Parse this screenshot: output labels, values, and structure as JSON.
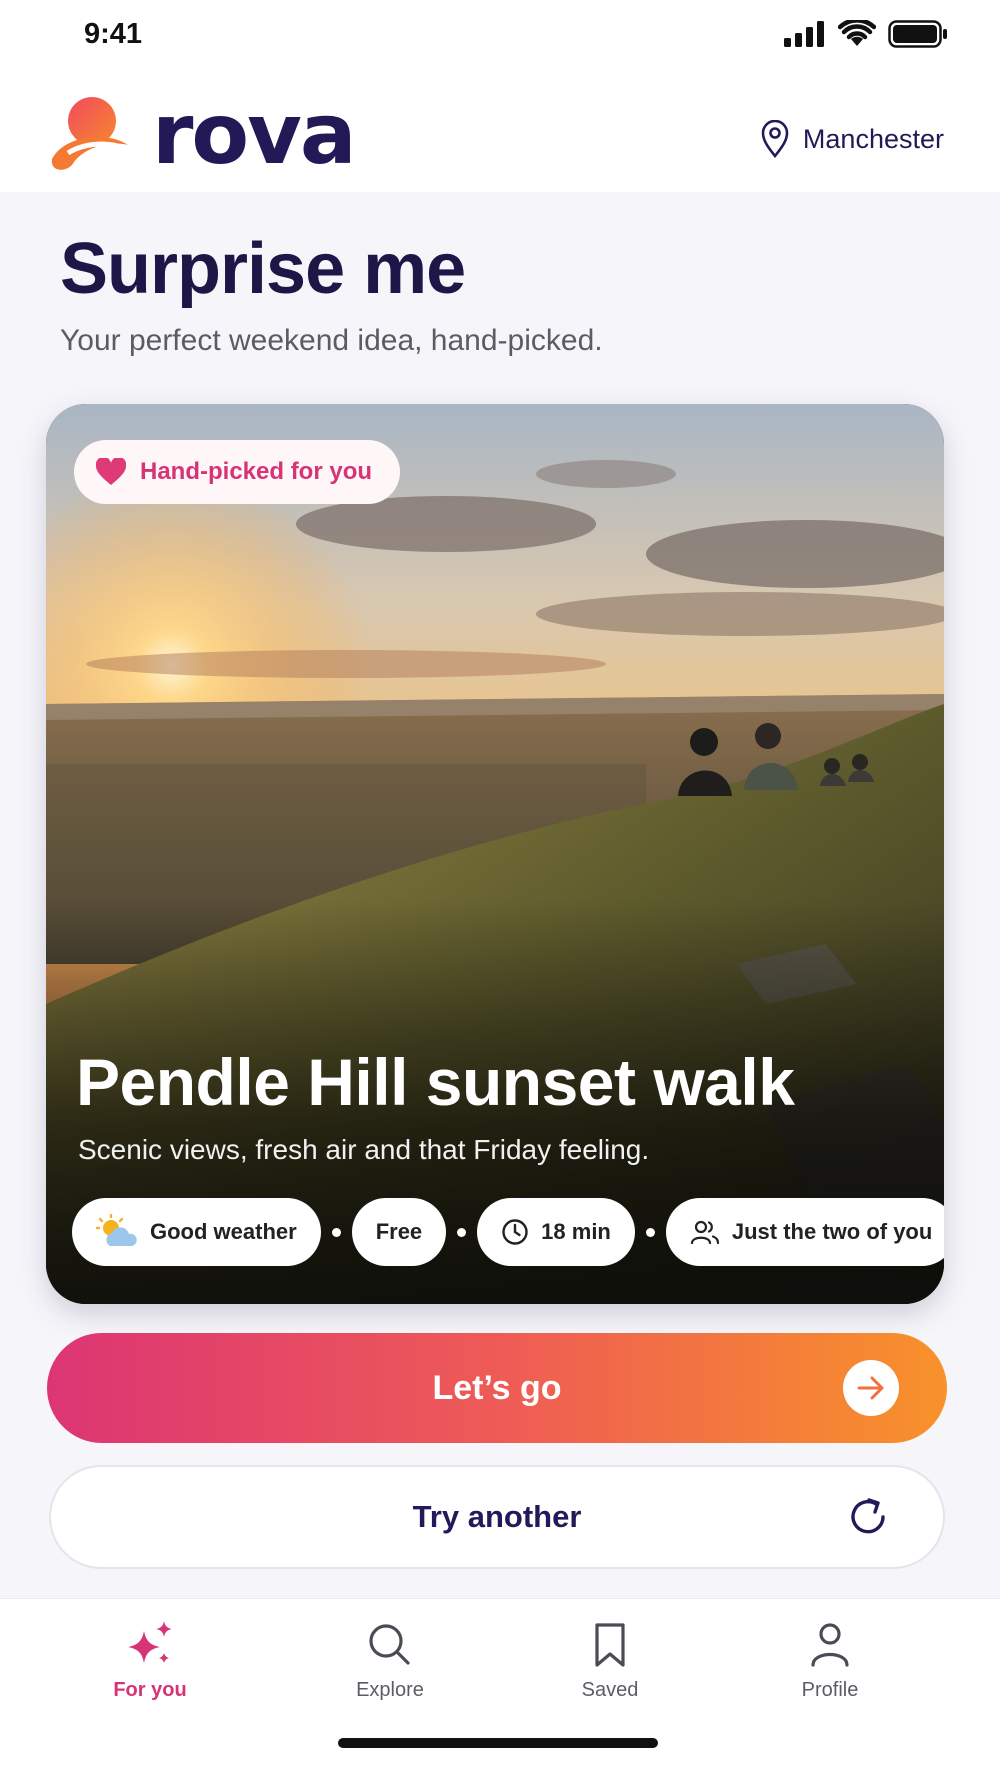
{
  "status_bar": {
    "time": "9:41",
    "icons": [
      "cellular-signal-icon",
      "wifi-icon",
      "battery-icon"
    ]
  },
  "header": {
    "brand": "rova",
    "location_icon": "map-pin-icon",
    "location": "Manchester"
  },
  "hero": {
    "title": "Surprise me",
    "subtitle": "Your perfect weekend idea, hand-picked."
  },
  "card": {
    "badge_icon": "heart-icon",
    "badge": "Hand-picked for you",
    "image": "sunset-hillside-photo",
    "title": "Pendle Hill sunset walk",
    "description": "Scenic views, fresh air and that Friday feeling.",
    "chips": [
      {
        "icon": "partly-sunny-icon",
        "label": "Good weather"
      },
      {
        "icon": "",
        "label": "Free"
      },
      {
        "icon": "clock-icon",
        "label": "18 min"
      },
      {
        "icon": "people-icon",
        "label": "Just the two of you"
      }
    ]
  },
  "actions": {
    "primary": "Let’s go",
    "primary_icon": "arrow-right-icon",
    "secondary": "Try another",
    "secondary_icon": "refresh-icon"
  },
  "tabs": [
    {
      "label": "For you",
      "icon": "sparkles-icon",
      "active": true
    },
    {
      "label": "Explore",
      "icon": "search-icon",
      "active": false
    },
    {
      "label": "Saved",
      "icon": "bookmark-icon",
      "active": false
    },
    {
      "label": "Profile",
      "icon": "person-icon",
      "active": false
    }
  ],
  "colors": {
    "brand_navy": "#231957",
    "accent_pink": "#d63474",
    "gradient_start": "#dc3574",
    "gradient_end": "#f8922a"
  }
}
